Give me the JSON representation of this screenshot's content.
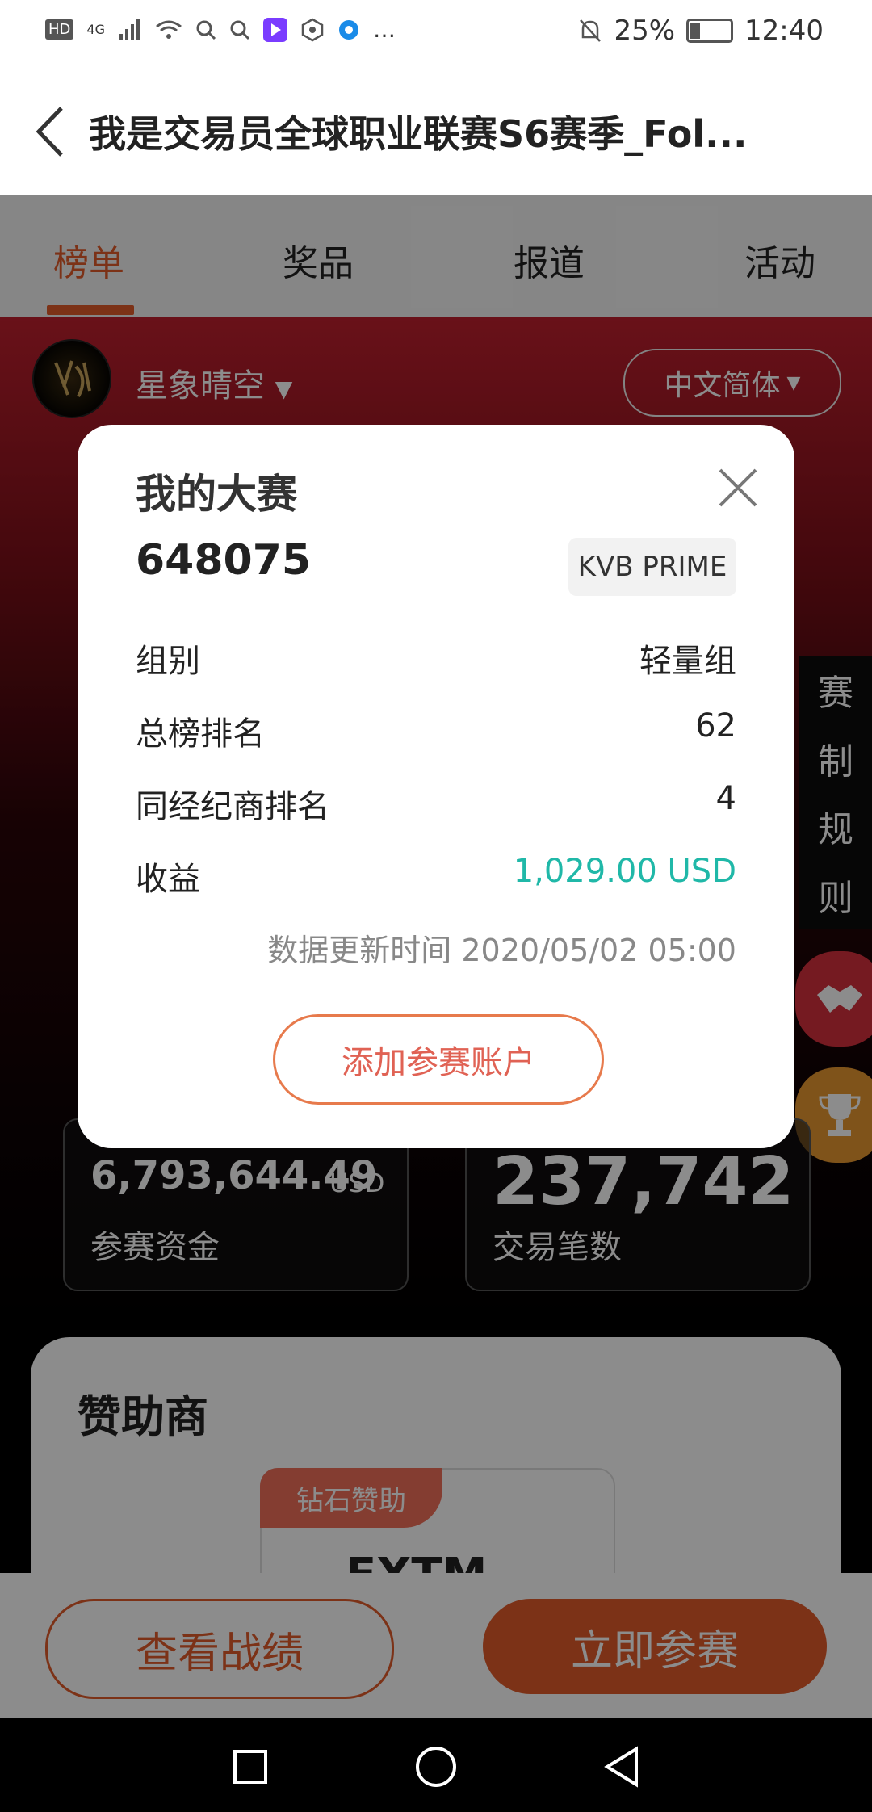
{
  "status_bar": {
    "left_icons": [
      "HD",
      "4G",
      "signal-icon",
      "wifi-icon",
      "search-icon",
      "search-icon",
      "video-app-icon",
      "hex-app-icon",
      "browser-app-icon",
      "…"
    ],
    "battery": "25%",
    "time": "12:40"
  },
  "title_bar": {
    "title": "我是交易员全球职业联赛S6赛季_Fol..."
  },
  "tabs": [
    {
      "label": "榜单",
      "active": true
    },
    {
      "label": "奖品",
      "active": false
    },
    {
      "label": "报道",
      "active": false
    },
    {
      "label": "活动",
      "active": false
    }
  ],
  "hero": {
    "username": "星象晴空",
    "language": "中文简体",
    "rules": [
      "赛",
      "制",
      "规",
      "则"
    ],
    "stats": [
      {
        "value": "6,793,644.49",
        "unit": "USD",
        "label": "参赛资金"
      },
      {
        "value": "237,742",
        "label": "交易笔数"
      }
    ]
  },
  "sponsor": {
    "title": "赞助商",
    "tag": "钻石赞助",
    "logo": "FXTM"
  },
  "bottom": {
    "record_label": "查看战绩",
    "join_label": "立即参赛"
  },
  "modal": {
    "title": "我的大赛",
    "account": "648075",
    "broker": "KVB PRIME",
    "rows": [
      {
        "label": "组别",
        "value": "轻量组"
      },
      {
        "label": "总榜排名",
        "value": "62"
      },
      {
        "label": "同经纪商排名",
        "value": "4"
      },
      {
        "label": "收益",
        "value": "1,029.00 USD"
      }
    ],
    "update_time": "数据更新时间 2020/05/02 05:00",
    "add_account": "添加参赛账户"
  },
  "colors": {
    "accent": "#e25b2a",
    "profit": "#20b8a8"
  }
}
